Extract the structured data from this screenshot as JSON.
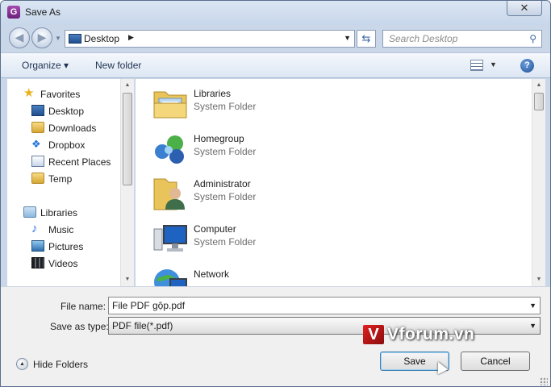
{
  "window": {
    "title": "Save As",
    "close_symbol": "✕"
  },
  "navigation": {
    "location": "Desktop",
    "search_placeholder": "Search Desktop"
  },
  "toolbar": {
    "organize_label": "Organize ▾",
    "new_folder_label": "New folder",
    "help_symbol": "?"
  },
  "nav_pane": {
    "favorites_header": "Favorites",
    "favorites": [
      {
        "label": "Desktop",
        "icon": "desktop-icon"
      },
      {
        "label": "Downloads",
        "icon": "folder-icon"
      },
      {
        "label": "Dropbox",
        "icon": "dropbox-icon"
      },
      {
        "label": "Recent Places",
        "icon": "recent-places-icon"
      },
      {
        "label": "Temp",
        "icon": "folder-icon"
      }
    ],
    "libraries_header": "Libraries",
    "libraries": [
      {
        "label": "Music",
        "icon": "music-icon"
      },
      {
        "label": "Pictures",
        "icon": "pictures-icon"
      },
      {
        "label": "Videos",
        "icon": "videos-icon"
      }
    ]
  },
  "files": [
    {
      "name": "Libraries",
      "type": "System Folder",
      "icon": "libraries-icon"
    },
    {
      "name": "Homegroup",
      "type": "System Folder",
      "icon": "homegroup-icon"
    },
    {
      "name": "Administrator",
      "type": "System Folder",
      "icon": "user-folder-icon"
    },
    {
      "name": "Computer",
      "type": "System Folder",
      "icon": "computer-icon"
    },
    {
      "name": "Network",
      "type": "",
      "icon": "network-icon"
    }
  ],
  "form": {
    "file_name_label": "File name:",
    "file_name_value": "File PDF gộp.pdf",
    "save_type_label": "Save as type:",
    "save_type_value": "PDF file(*.pdf)"
  },
  "footer": {
    "hide_folders_label": "Hide Folders",
    "save_label": "Save",
    "cancel_label": "Cancel"
  },
  "watermark": {
    "logo_letter": "V",
    "text": "Vforum.vn"
  }
}
